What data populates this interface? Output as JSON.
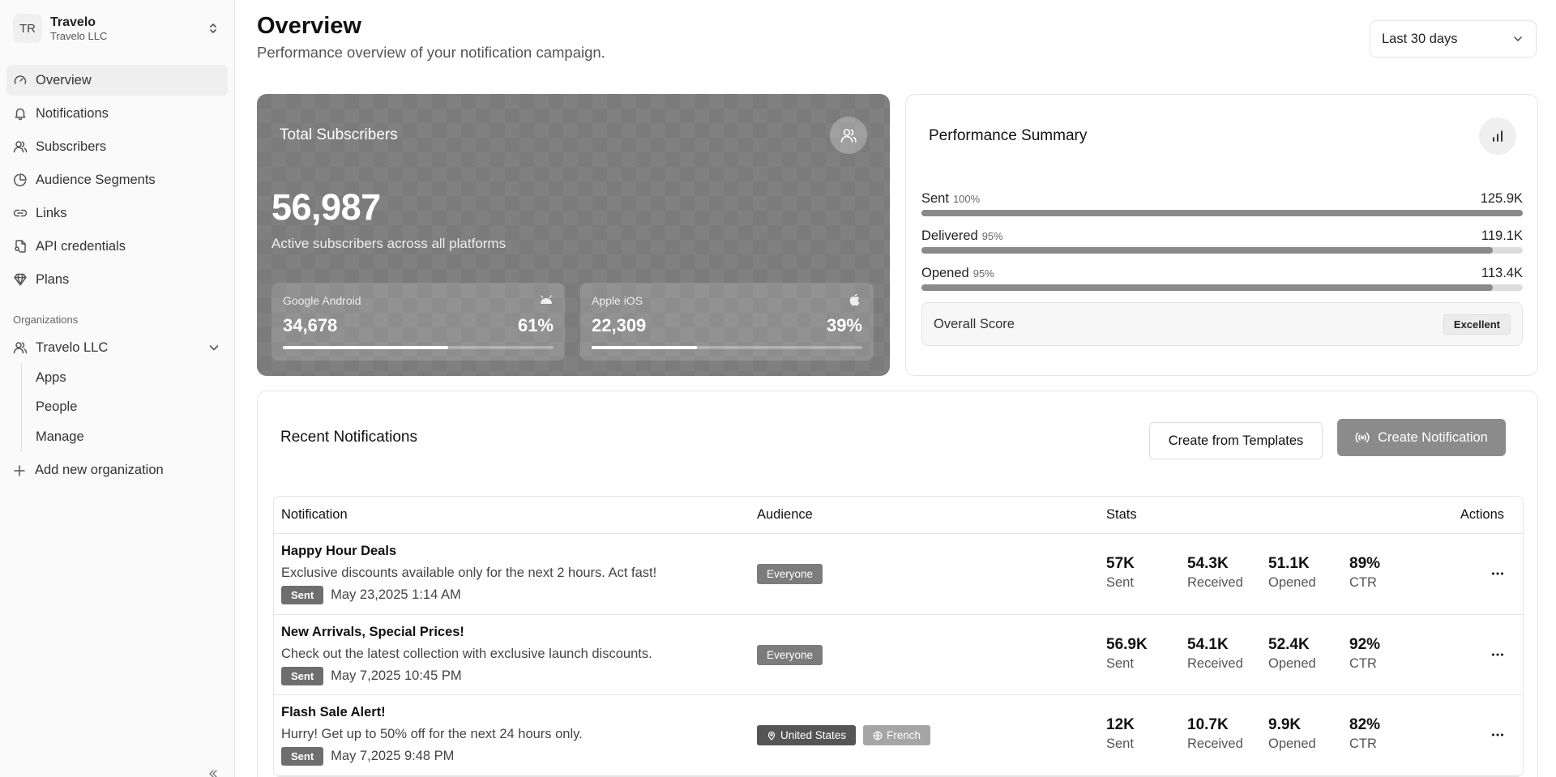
{
  "org_switcher": {
    "initials": "TR",
    "name": "Travelo",
    "sub": "Travelo LLC"
  },
  "nav": [
    {
      "label": "Overview",
      "icon": "gauge-icon"
    },
    {
      "label": "Notifications",
      "icon": "bell-icon"
    },
    {
      "label": "Subscribers",
      "icon": "users-icon"
    },
    {
      "label": "Audience Segments",
      "icon": "pie-chart-icon"
    },
    {
      "label": "Links",
      "icon": "link-icon"
    },
    {
      "label": "API credentials",
      "icon": "key-file-icon"
    },
    {
      "label": "Plans",
      "icon": "gem-icon"
    }
  ],
  "organizations": {
    "section_label": "Organizations",
    "org_name": "Travelo LLC",
    "sub_items": [
      "Apps",
      "People",
      "Manage"
    ],
    "add_label": "Add new organization"
  },
  "header": {
    "title": "Overview",
    "subtitle": "Performance overview of your notification campaign.",
    "range": "Last 30 days"
  },
  "subscribers": {
    "title": "Total Subscribers",
    "total": "56,987",
    "caption": "Active subscribers across all platforms",
    "android": {
      "name": "Google Android",
      "count": "34,678",
      "pct": "61%",
      "fraction": 0.61
    },
    "ios": {
      "name": "Apple iOS",
      "count": "22,309",
      "pct": "39%",
      "fraction": 0.39
    }
  },
  "performance": {
    "title": "Performance Summary",
    "metrics": [
      {
        "label": "Sent",
        "pct": "100%",
        "value": "125.9K",
        "fraction": 1.0
      },
      {
        "label": "Delivered",
        "pct": "95%",
        "value": "119.1K",
        "fraction": 0.95
      },
      {
        "label": "Opened",
        "pct": "95%",
        "value": "113.4K",
        "fraction": 0.95
      }
    ],
    "score_label": "Overall Score",
    "score_value": "Excellent"
  },
  "recent": {
    "title": "Recent Notifications",
    "btn_templates": "Create from Templates",
    "btn_create": "Create Notification",
    "columns": {
      "notification": "Notification",
      "audience": "Audience",
      "stats": "Stats",
      "actions": "Actions"
    },
    "rows": [
      {
        "title": "Happy Hour Deals",
        "desc": "Exclusive discounts available only for the next 2 hours. Act fast!",
        "status": "Sent",
        "date": "May 23,2025 1:14 AM",
        "audience": [
          {
            "label": "Everyone"
          }
        ],
        "stats": [
          {
            "value": "57K",
            "label": "Sent"
          },
          {
            "value": "54.3K",
            "label": "Received"
          },
          {
            "value": "51.1K",
            "label": "Opened"
          },
          {
            "value": "89%",
            "label": "CTR"
          }
        ]
      },
      {
        "title": "New Arrivals, Special Prices!",
        "desc": "Check out the latest collection with exclusive launch discounts.",
        "status": "Sent",
        "date": "May 7,2025 10:45 PM",
        "audience": [
          {
            "label": "Everyone"
          }
        ],
        "stats": [
          {
            "value": "56.9K",
            "label": "Sent"
          },
          {
            "value": "54.1K",
            "label": "Received"
          },
          {
            "value": "52.4K",
            "label": "Opened"
          },
          {
            "value": "92%",
            "label": "CTR"
          }
        ]
      },
      {
        "title": "Flash Sale Alert!",
        "desc": "Hurry! Get up to 50% off for the next 24 hours only.",
        "status": "Sent",
        "date": "May 7,2025 9:48 PM",
        "audience": [
          {
            "label": "United States",
            "icon": "map-pin-icon"
          },
          {
            "label": "French",
            "icon": "globe-icon"
          }
        ],
        "stats": [
          {
            "value": "12K",
            "label": "Sent"
          },
          {
            "value": "10.7K",
            "label": "Received"
          },
          {
            "value": "9.9K",
            "label": "Opened"
          },
          {
            "value": "82%",
            "label": "CTR"
          }
        ]
      }
    ]
  }
}
